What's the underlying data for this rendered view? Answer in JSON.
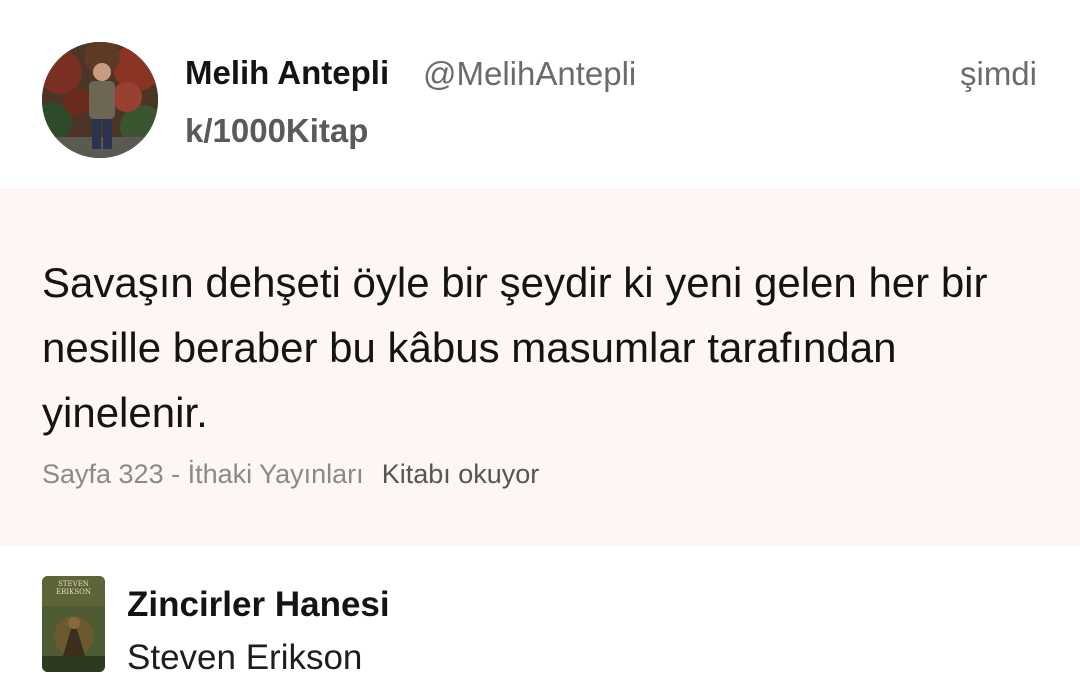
{
  "post": {
    "user_name": "Melih Antepli",
    "user_handle": "@MelihAntepli",
    "community": "k/1000Kitap",
    "timestamp": "şimdi"
  },
  "quote": {
    "text": "Savaşın dehşeti öyle bir şeydir ki yeni gelen her bir nesille beraber bu kâbus masumlar tarafından yinelenir.",
    "page_info": "Sayfa 323 - İthaki Yayınları",
    "reading_status": "Kitabı okuyor"
  },
  "book": {
    "title": "Zincirler Hanesi",
    "author": "Steven Erikson",
    "cover_text": "STEVEN ERIKSON"
  },
  "colors": {
    "quote_background": "#fdf6f2",
    "muted_text": "#6b6b6b"
  }
}
